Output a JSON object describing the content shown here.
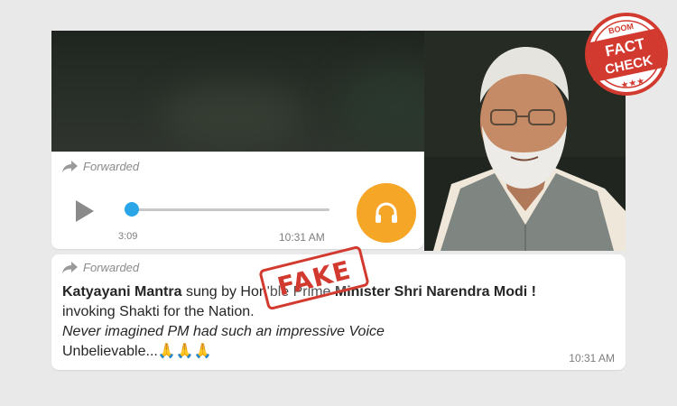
{
  "audio_message": {
    "forwarded_label": "Forwarded",
    "duration": "3:09",
    "time": "10:31 AM",
    "progress": 0.03
  },
  "text_message": {
    "forwarded_label": "Forwarded",
    "line1_bold_a": "Katyayani Mantra",
    "line1_text": " sung by Hon'ble Prime ",
    "line1_bold_b": "Minister Shri Narendra Modi !",
    "line2": "invoking Shakti for the Nation.",
    "line3": "Never imagined PM had such an impressive Voice",
    "line4": "Unbelievable...",
    "line4_emoji": "🙏🙏🙏",
    "time": "10:31 AM"
  },
  "stamp": {
    "text": "FAKE"
  },
  "logo": {
    "top": "BOOM",
    "line1": "FACT",
    "line2": "CHECK",
    "stars": "★★★"
  },
  "colors": {
    "accent_orange": "#f6a626",
    "progress_blue": "#2aa6e8",
    "stamp_red": "#d23a2f"
  }
}
